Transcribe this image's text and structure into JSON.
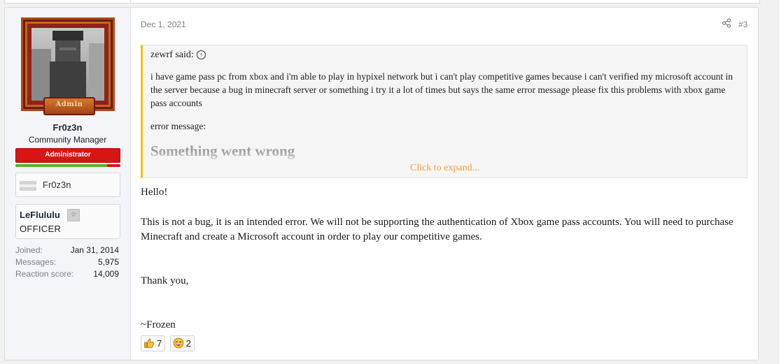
{
  "user": {
    "avatar_badge": "Admin",
    "username": "Fr0z3n",
    "title": "Community Manager",
    "banner": "Administrator",
    "reputation_fraction": 0.87,
    "minecraft_name": "Fr0z3n",
    "guild": {
      "name": "LeFlululu",
      "star": "☆",
      "rank": "OFFICER"
    },
    "stats": [
      {
        "label": "Joined:",
        "value": "Jan 31, 2014"
      },
      {
        "label": "Messages:",
        "value": "5,975"
      },
      {
        "label": "Reaction score:",
        "value": "14,009"
      }
    ]
  },
  "post": {
    "date": "Dec 1, 2021",
    "number": "#3",
    "quote": {
      "author": "zewrf said:",
      "text": "i have game pass pc from xbox and i'm able to play in hypixel network but i can't play competitive games because i can't verified my microsoft account in the server because a bug in minecraft server or something i try it a lot of times but says the same error message please fix this problems with xbox game pass accounts",
      "error_label": "error message:",
      "error_title": "Something went wrong",
      "expand": "Click to expand..."
    },
    "body": {
      "greeting": "Hello!",
      "paragraph": "This is not a bug, it is an intended error. We will not be supporting the authentication of Xbox game pass accounts. You will need to purchase Minecraft and create a Microsoft account in order to play our competitive games.",
      "thanks": "Thank you,",
      "signature": "~Frozen"
    },
    "reactions": [
      {
        "icon": "thumbs-up-icon",
        "count": "7"
      },
      {
        "icon": "laughing-face-icon",
        "count": "2"
      }
    ]
  },
  "colors": {
    "admin_banner": "#d81515",
    "quote_border": "#f1c40f",
    "expand_link": "#f0a030",
    "rep_positive": "#5cb030"
  }
}
